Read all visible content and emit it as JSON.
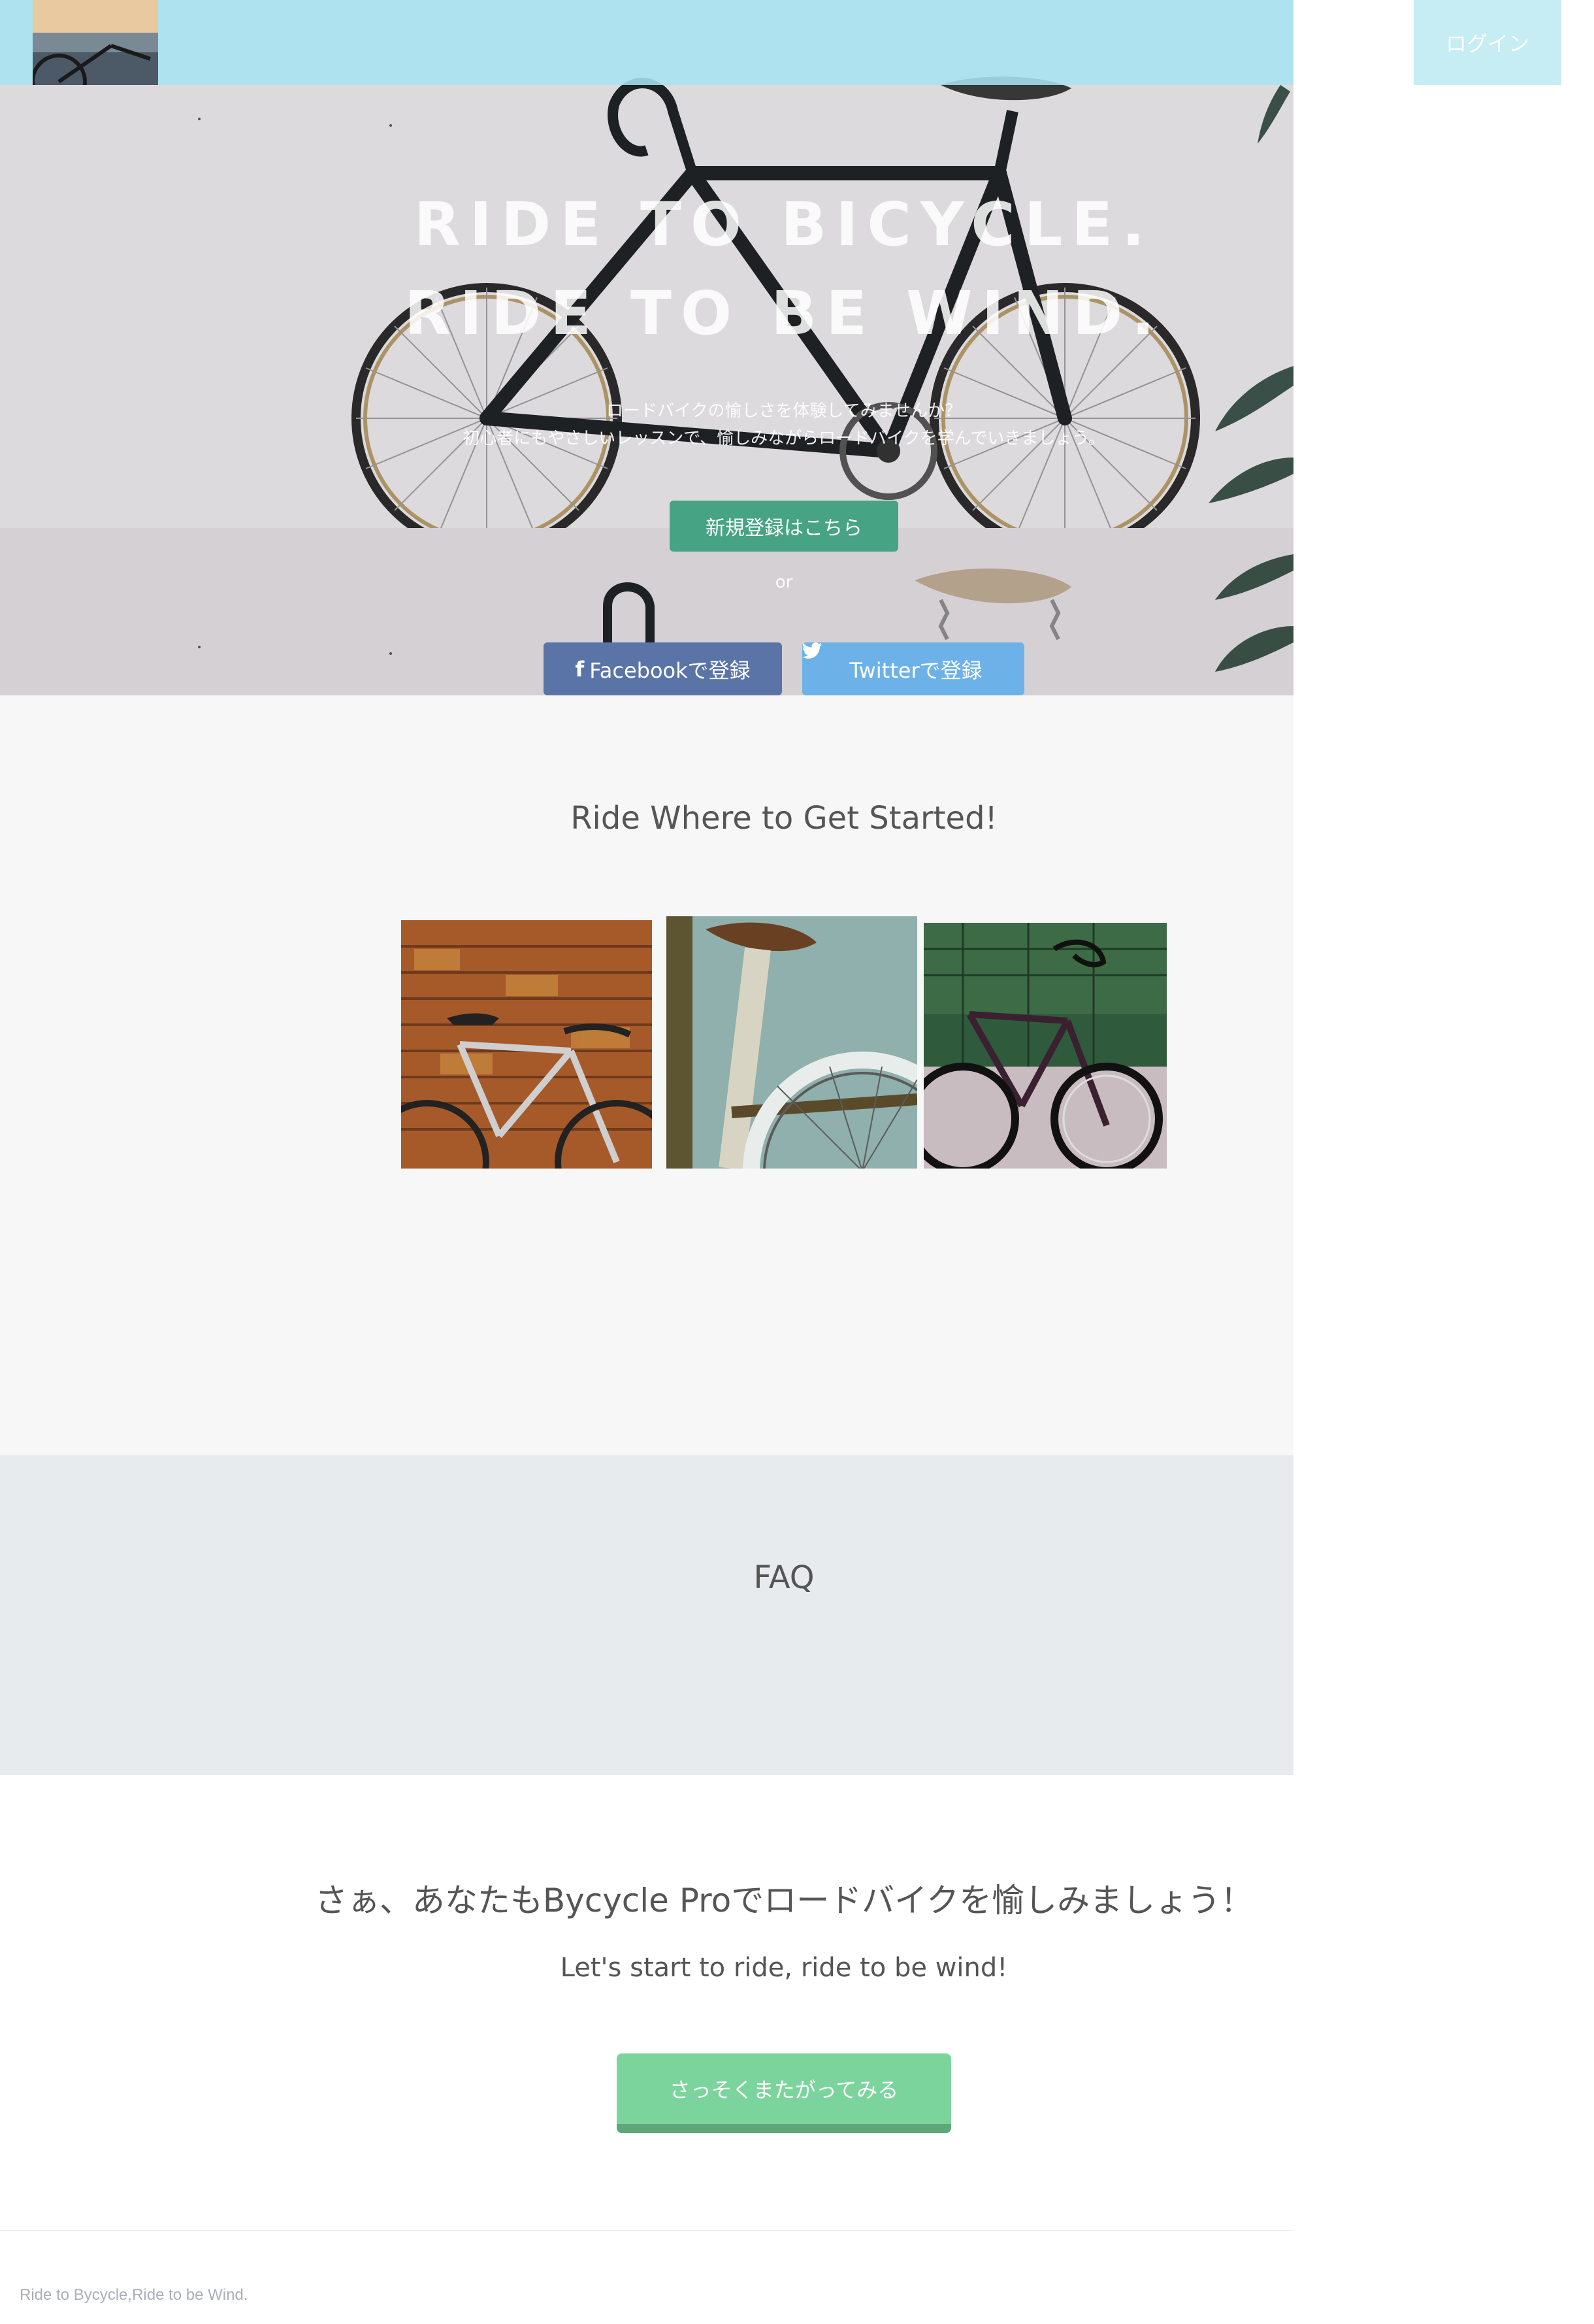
{
  "header": {
    "logo_alt": "Bycycle Pro",
    "login_label": "ログイン"
  },
  "hero": {
    "headline_1": "RIDE TO BICYCLE.",
    "headline_2": "RIDE TO BE WIND.",
    "copy_1": "ロードバイクの愉しさを体験してみませんか？",
    "copy_2": "初心者にもやさしいレッスンで、愉しみながらロードバイクを学んでいきましょう。",
    "signup_label": "新規登録はこちら",
    "or_label": "or",
    "facebook_icon": "f",
    "facebook_label": "Facebookで登録",
    "twitter_icon": "twitter-bird",
    "twitter_label": "Twitterで登録"
  },
  "started": {
    "title": "Ride Where to Get Started!",
    "images": [
      "bike-against-brick-wall",
      "white-frame-bike-wheel",
      "dark-bike-on-pavement"
    ]
  },
  "faq": {
    "title": "FAQ"
  },
  "cta": {
    "title": "さぁ、あなたもBycycle Proでロードバイクを愉しみましょう！",
    "subtitle": "Let's start to ride, ride to be wind!",
    "button_label": "さっそくまたがってみる"
  },
  "footer": {
    "text": "Ride to Bycycle,Ride to be Wind."
  },
  "colors": {
    "header_bg": "#a6e2f0",
    "signup_btn": "#46a383",
    "facebook_btn": "#5a74a8",
    "twitter_btn": "#6cb2e8",
    "cta_btn": "#7cd49d",
    "faq_bg": "#e8ebee",
    "started_bg": "#f7f7f7"
  }
}
